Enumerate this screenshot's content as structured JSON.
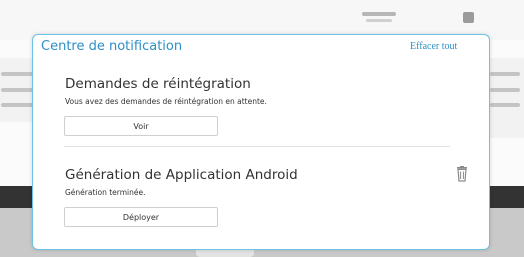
{
  "notification_center": {
    "title": "Centre de notification",
    "clear_all_label": "Effacer tout",
    "notifications": [
      {
        "title": "Demandes de réintégration",
        "message": "Vous avez des demandes de réintégration en attente.",
        "action_label": "Voir"
      },
      {
        "title": "Génération de Application Android",
        "message": "Génération terminée.",
        "action_label": "Déployer",
        "delete_icon": "trash-icon"
      }
    ]
  },
  "colors": {
    "accent": "#2d8fc6",
    "panel_border": "#6cc2e6",
    "text": "#333333"
  }
}
